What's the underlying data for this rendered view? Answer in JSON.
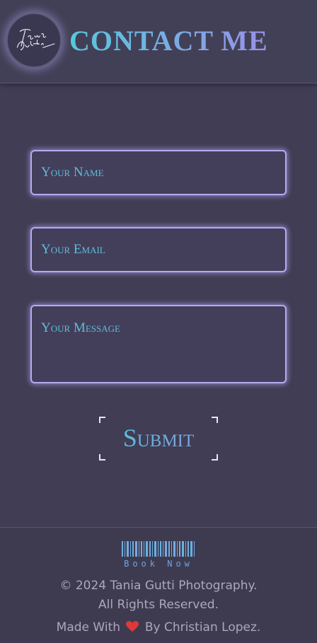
{
  "header": {
    "logo_text": "Tania Gutti",
    "title": "CONTACT ME"
  },
  "form": {
    "name_placeholder": "Your Name",
    "email_placeholder": "Your Email",
    "message_placeholder": "Your Message",
    "submit_label": "Submit"
  },
  "footer": {
    "book_now": "Book Now",
    "copyright_line1": "© 2024 Tania Gutti Photography.",
    "copyright_line2": "All Rights Reserved.",
    "made_with_prefix": "Made With",
    "made_with_suffix": "By Christian Lopez."
  },
  "icons": {
    "heart": "heart-icon",
    "barcode": "barcode-icon"
  },
  "colors": {
    "background": "#403d54",
    "accent_cyan": "#57c8da",
    "accent_violet": "#b7aaf0",
    "heart": "#e0373a"
  }
}
